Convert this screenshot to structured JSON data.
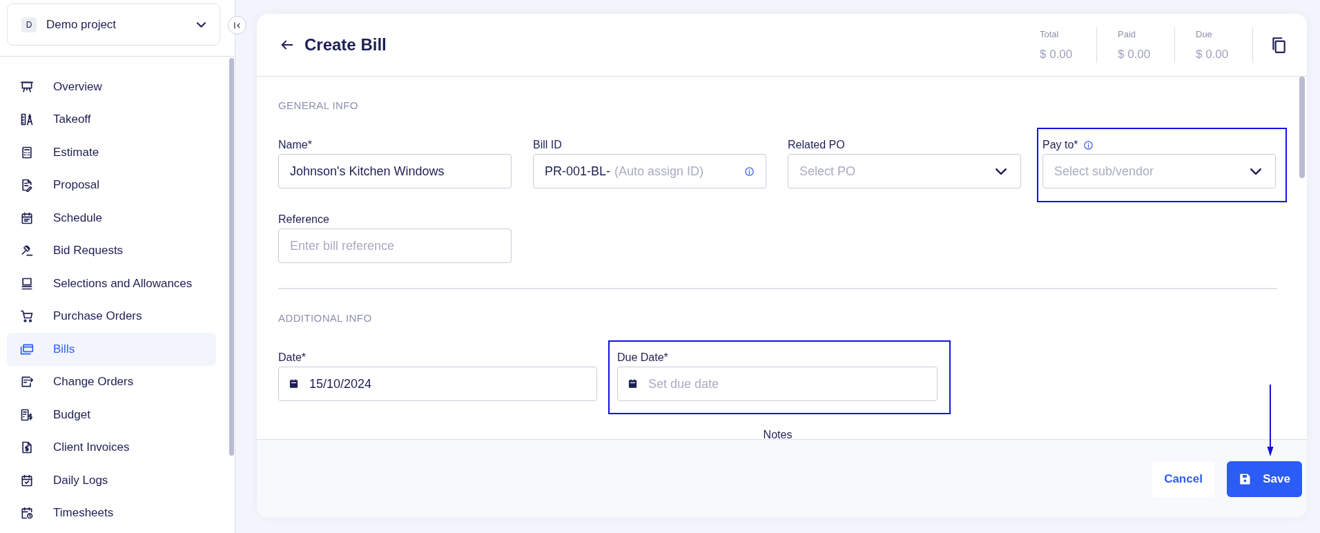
{
  "project": {
    "initial": "D",
    "name": "Demo project"
  },
  "sidebar": {
    "items": [
      {
        "label": "Overview",
        "selected": false
      },
      {
        "label": "Takeoff",
        "selected": false
      },
      {
        "label": "Estimate",
        "selected": false
      },
      {
        "label": "Proposal",
        "selected": false
      },
      {
        "label": "Schedule",
        "selected": false
      },
      {
        "label": "Bid Requests",
        "selected": false
      },
      {
        "label": "Selections and Allowances",
        "selected": false
      },
      {
        "label": "Purchase Orders",
        "selected": false
      },
      {
        "label": "Bills",
        "selected": true
      },
      {
        "label": "Change Orders",
        "selected": false
      },
      {
        "label": "Budget",
        "selected": false
      },
      {
        "label": "Client Invoices",
        "selected": false
      },
      {
        "label": "Daily Logs",
        "selected": false
      },
      {
        "label": "Timesheets",
        "selected": false
      }
    ]
  },
  "header": {
    "title": "Create Bill",
    "totals": [
      {
        "label": "Total",
        "value": "$ 0.00"
      },
      {
        "label": "Paid",
        "value": "$ 0.00"
      },
      {
        "label": "Due",
        "value": "$ 0.00"
      }
    ]
  },
  "general_info": {
    "heading": "GENERAL INFO",
    "fields": [
      {
        "kind": "text",
        "label": "Name*",
        "value": "Johnson's Kitchen Windows",
        "highlighted": false
      },
      {
        "kind": "id",
        "label": "Bill ID",
        "value": "PR-001-BL-",
        "placeholder": "(Auto assign ID)",
        "highlighted": false
      },
      {
        "kind": "select",
        "label": "Related PO",
        "placeholder": "Select PO",
        "highlighted": false
      },
      {
        "kind": "select",
        "label": "Pay to*",
        "placeholder": "Select sub/vendor",
        "info": true,
        "highlighted": true
      },
      {
        "kind": "text",
        "label": "Reference",
        "placeholder": "Enter bill reference",
        "highlighted": false
      }
    ]
  },
  "additional_info": {
    "heading": "ADDITIONAL INFO",
    "fields": [
      {
        "kind": "date",
        "label": "Date*",
        "value": "15/10/2024",
        "highlighted": false
      },
      {
        "kind": "date",
        "label": "Due Date*",
        "placeholder": "Set due date",
        "highlighted": true
      }
    ],
    "notes_label": "Notes"
  },
  "footer": {
    "cancel": "Cancel",
    "save": "Save",
    "save_pointer_arrow": true
  }
}
